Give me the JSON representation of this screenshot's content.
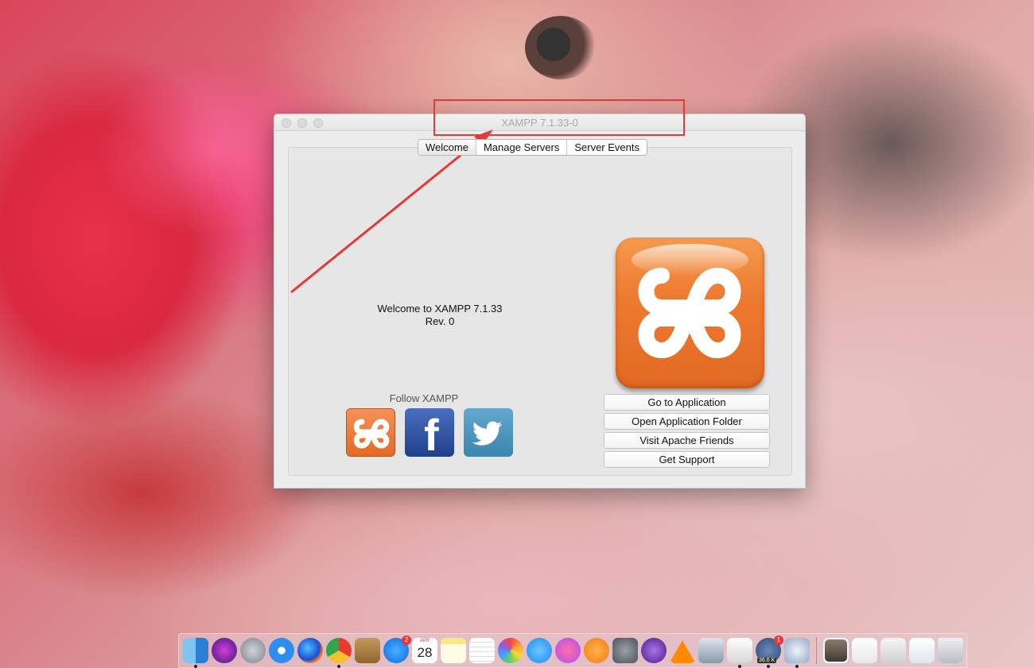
{
  "window": {
    "title": "XAMPP 7.1.33-0",
    "tabs": [
      "Welcome",
      "Manage Servers",
      "Server Events"
    ],
    "active_tab": "Welcome",
    "welcome_line1": "Welcome to XAMPP 7.1.33",
    "welcome_line2": "Rev. 0",
    "follow_label": "Follow  XAMPP",
    "buttons": {
      "go_to_application": "Go to Application",
      "open_application_folder": "Open Application Folder",
      "visit_apache_friends": "Visit Apache Friends",
      "get_support": "Get Support"
    }
  },
  "annotation": {
    "color": "#e53935"
  },
  "dock": {
    "calendar_month": "APR",
    "calendar_day": "28",
    "app_store_badge": "2",
    "network_badge": "1",
    "network_label": "36.6 K"
  },
  "colors": {
    "xampp_orange": "#ee7a30",
    "facebook_blue": "#2d4f9e",
    "twitter_blue": "#4a95bf"
  }
}
